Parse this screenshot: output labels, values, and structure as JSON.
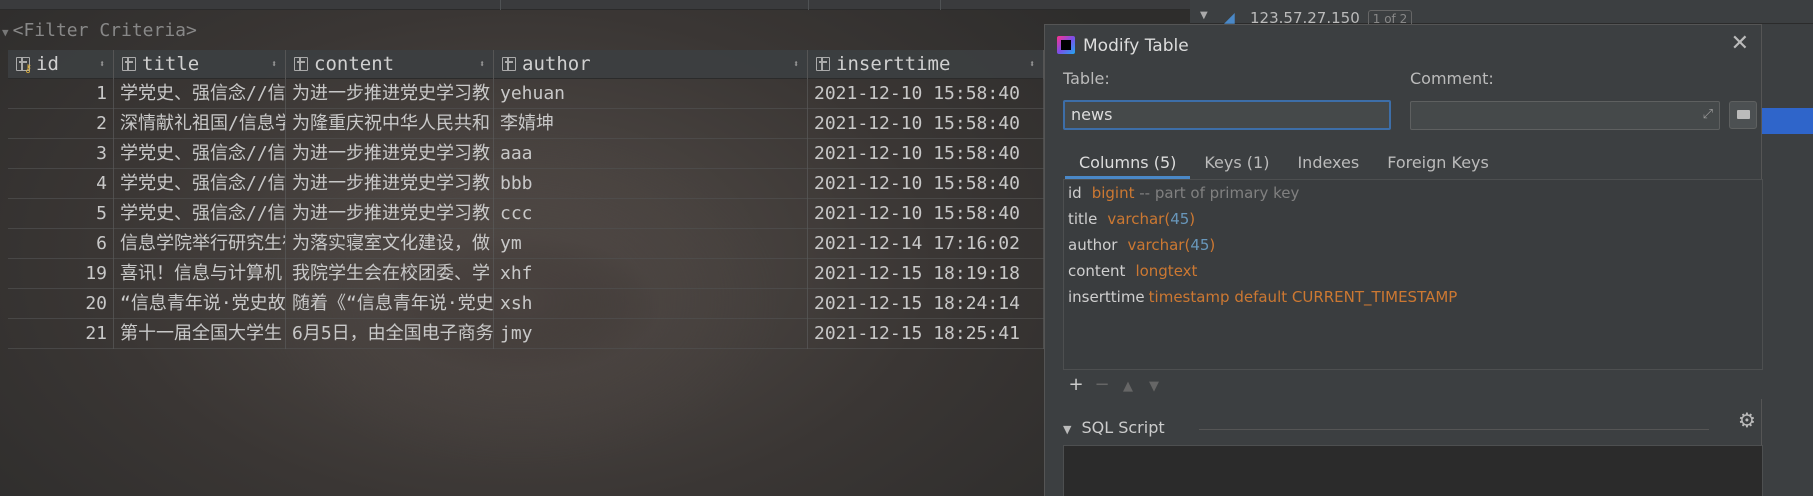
{
  "filter": {
    "text": "<Filter Criteria>"
  },
  "grid": {
    "columns": [
      "id",
      "title",
      "content",
      "author",
      "inserttime"
    ],
    "rows": [
      {
        "id": "1",
        "title": "学党史、强信念//信",
        "content": "为进一步推进党史学习教",
        "author": "yehuan",
        "time": "2021-12-10 15:58:40"
      },
      {
        "id": "2",
        "title": "深情献礼祖国/信息学",
        "content": "为隆重庆祝中华人民共和",
        "author": "李婧坤",
        "time": "2021-12-10 15:58:40"
      },
      {
        "id": "3",
        "title": "学党史、强信念//信",
        "content": "为进一步推进党史学习教",
        "author": "aaa",
        "time": "2021-12-10 15:58:40"
      },
      {
        "id": "4",
        "title": "学党史、强信念//信",
        "content": "为进一步推进党史学习教",
        "author": "bbb",
        "time": "2021-12-10 15:58:40"
      },
      {
        "id": "5",
        "title": "学党史、强信念//信",
        "content": "为进一步推进党史学习教",
        "author": "ccc",
        "time": "2021-12-10 15:58:40"
      },
      {
        "id": "6",
        "title": "信息学院举行研究生宿",
        "content": "为落实寝室文化建设，做",
        "author": "ym",
        "time": "2021-12-14 17:16:02"
      },
      {
        "id": "19",
        "title": "喜讯！信息与计算机",
        "content": "我院学生会在校团委、学",
        "author": "xhf",
        "time": "2021-12-15 18:19:18"
      },
      {
        "id": "20",
        "title": "“信息青年说·党史故",
        "content": "随着《“信息青年说·党史",
        "author": "xsh",
        "time": "2021-12-15 18:24:14"
      },
      {
        "id": "21",
        "title": "第十一届全国大学生",
        "content": "6月5日，由全国电子商务",
        "author": "jmy",
        "time": "2021-12-15 18:25:41"
      }
    ]
  },
  "right_panel": {
    "host": "123.57.27.150",
    "badge": "1 of 2"
  },
  "dialog": {
    "title": "Modify Table",
    "table_label": "Table:",
    "table_value": "news",
    "comment_label": "Comment:",
    "tabs": [
      "Columns (5)",
      "Keys (1)",
      "Indexes",
      "Foreign Keys"
    ],
    "columns": [
      {
        "name": "id",
        "type": "bigint",
        "param": "",
        "comment": "-- part of primary key"
      },
      {
        "name": "title",
        "type": "varchar(",
        "param": "45",
        "close": ")"
      },
      {
        "name": "author",
        "type": "varchar(",
        "param": "45",
        "close": ")"
      },
      {
        "name": "content",
        "type": "longtext",
        "param": ""
      },
      {
        "name": "inserttime",
        "type": "timestamp default CURRENT_TIMESTAMP",
        "param": ""
      }
    ],
    "sql_label": "SQL Script"
  }
}
